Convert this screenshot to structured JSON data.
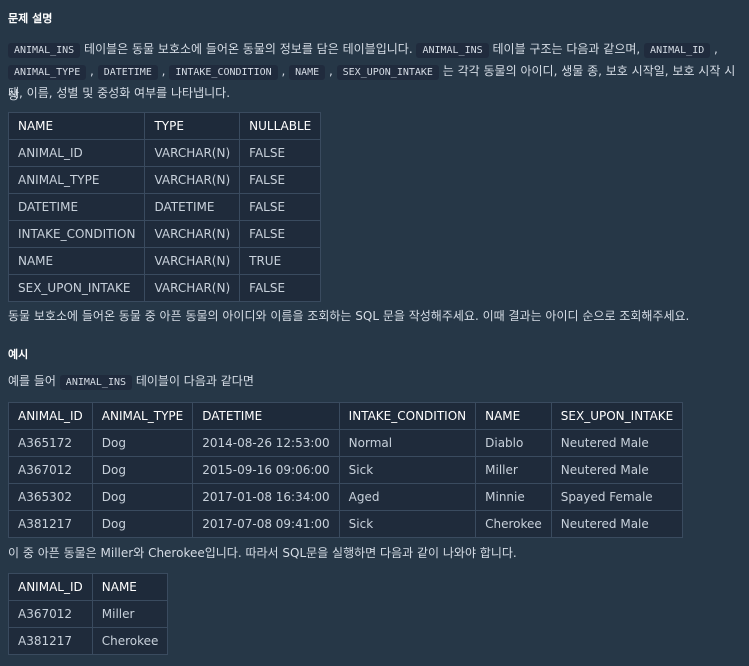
{
  "section_title": "문제 설명",
  "intro": {
    "code1": "ANIMAL_INS",
    "t1": " 테이블은 동물 보호소에 들어온 동물의 정보를 담은 테이블입니다. ",
    "code2": "ANIMAL_INS",
    "t2": " 테이블 구조는 다음과 같으며, ",
    "code3": "ANIMAL_ID",
    "sep": " , ",
    "code4": "ANIMAL_TYPE",
    "code5": "DATETIME",
    "code6": "INTAKE_CONDITION",
    "code7": "NAME",
    "code8": "SEX_UPON_INTAKE",
    "t3": " 는 각각 동물의 아이디, 생물 종, 보호 시작일, 보호 시작 시 상",
    "t4": "태, 이름, 성별 및 중성화 여부를 나타냅니다."
  },
  "schema_table": {
    "headers": [
      "NAME",
      "TYPE",
      "NULLABLE"
    ],
    "rows": [
      [
        "ANIMAL_ID",
        "VARCHAR(N)",
        "FALSE"
      ],
      [
        "ANIMAL_TYPE",
        "VARCHAR(N)",
        "FALSE"
      ],
      [
        "DATETIME",
        "DATETIME",
        "FALSE"
      ],
      [
        "INTAKE_CONDITION",
        "VARCHAR(N)",
        "FALSE"
      ],
      [
        "NAME",
        "VARCHAR(N)",
        "TRUE"
      ],
      [
        "SEX_UPON_INTAKE",
        "VARCHAR(N)",
        "FALSE"
      ]
    ]
  },
  "question": "동물 보호소에 들어온 동물 중 아픈 동물의 아이디와 이름을 조회하는 SQL 문을 작성해주세요. 이때 결과는 아이디 순으로 조회해주세요.",
  "example_title": "예시",
  "example_intro": {
    "t1": "예를 들어 ",
    "code": "ANIMAL_INS",
    "t2": " 테이블이 다음과 같다면"
  },
  "example_table": {
    "headers": [
      "ANIMAL_ID",
      "ANIMAL_TYPE",
      "DATETIME",
      "INTAKE_CONDITION",
      "NAME",
      "SEX_UPON_INTAKE"
    ],
    "rows": [
      [
        "A365172",
        "Dog",
        "2014-08-26 12:53:00",
        "Normal",
        "Diablo",
        "Neutered Male"
      ],
      [
        "A367012",
        "Dog",
        "2015-09-16 09:06:00",
        "Sick",
        "Miller",
        "Neutered Male"
      ],
      [
        "A365302",
        "Dog",
        "2017-01-08 16:34:00",
        "Aged",
        "Minnie",
        "Spayed Female"
      ],
      [
        "A381217",
        "Dog",
        "2017-07-08 09:41:00",
        "Sick",
        "Cherokee",
        "Neutered Male"
      ]
    ]
  },
  "result_intro": "이 중 아픈 동물은 Miller와 Cherokee입니다. 따라서 SQL문을 실행하면 다음과 같이 나와야 합니다.",
  "result_table": {
    "headers": [
      "ANIMAL_ID",
      "NAME"
    ],
    "rows": [
      [
        "A367012",
        "Miller"
      ],
      [
        "A381217",
        "Cherokee"
      ]
    ]
  }
}
